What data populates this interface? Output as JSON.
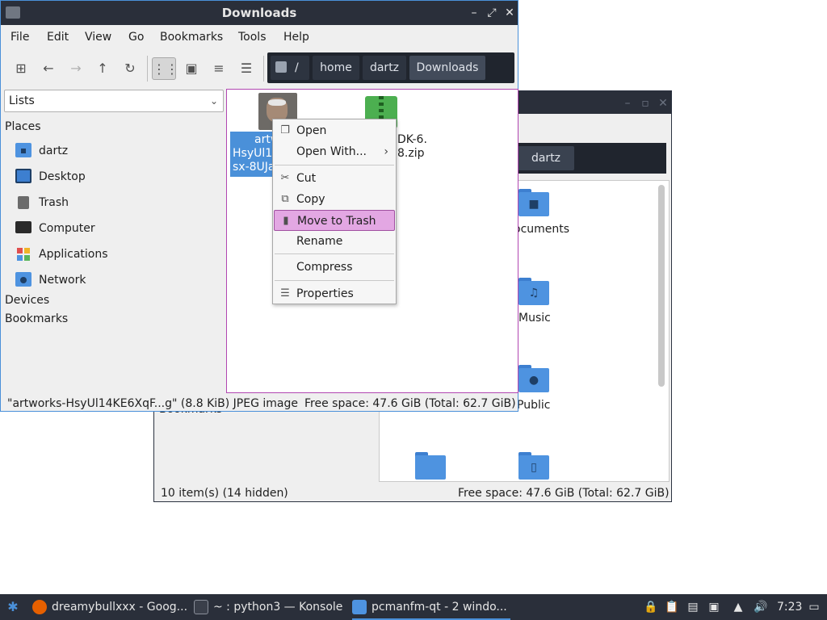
{
  "back_window": {
    "path_current": "dartz",
    "files": [
      {
        "label": "ocuments",
        "glyph": "■"
      },
      {
        "label": "Music",
        "glyph": "♫"
      },
      {
        "label": "Public",
        "glyph": "●"
      },
      {
        "label": "",
        "glyph": ""
      },
      {
        "label": "",
        "glyph": "▯"
      }
    ],
    "obscured_sidebar_text": "Bookmarks",
    "status_left": "10 item(s) (14 hidden)",
    "status_right": "Free space: 47.6 GiB (Total: 62.7 GiB)"
  },
  "window": {
    "title": "Downloads",
    "menu": [
      "File",
      "Edit",
      "View",
      "Go",
      "Bookmarks",
      "Tools",
      "Help"
    ],
    "path": [
      "home",
      "dartz",
      "Downloads"
    ],
    "path_root": "/"
  },
  "sidebar": {
    "view_select": "Lists",
    "places_header": "Places",
    "places": [
      {
        "label": "dartz",
        "icon": "home-folder-icon"
      },
      {
        "label": "Desktop",
        "icon": "desktop-icon"
      },
      {
        "label": "Trash",
        "icon": "trash-icon"
      },
      {
        "label": "Computer",
        "icon": "computer-icon"
      },
      {
        "label": "Applications",
        "icon": "applications-icon"
      },
      {
        "label": "Network",
        "icon": "network-icon"
      }
    ],
    "devices_header": "Devices",
    "bookmarks_header": "Bookmarks"
  },
  "files": [
    {
      "name_lines": [
        "artw",
        "HsyUl14",
        "sx-8UJa"
      ],
      "type": "jpeg",
      "selected": true
    },
    {
      "name_lines": [
        "DK-6.",
        "8.zip"
      ],
      "type": "zip",
      "selected": false
    }
  ],
  "context_menu": {
    "items": [
      {
        "label": "Open",
        "icon": "open-icon"
      },
      {
        "label": "Open With...",
        "icon": "",
        "submenu": true
      },
      {
        "label": "Cut",
        "icon": "scissors-icon"
      },
      {
        "label": "Copy",
        "icon": "copy-icon"
      },
      {
        "label": "Move to Trash",
        "icon": "trash-icon",
        "highlighted": true
      },
      {
        "label": "Rename",
        "icon": ""
      },
      {
        "label": "Compress",
        "icon": ""
      },
      {
        "label": "Properties",
        "icon": "properties-icon"
      }
    ]
  },
  "status": {
    "left": "\"artworks-HsyUl14KE6XqF...g\" (8.8 KiB) JPEG image",
    "right": "Free space: 47.6 GiB (Total: 62.7 GiB)"
  },
  "taskbar": {
    "tasks": [
      {
        "label": "dreamybullxxx - Goog...",
        "icon": "firefox-icon"
      },
      {
        "label": "~ : python3 — Konsole",
        "icon": "terminal-icon"
      },
      {
        "label": "pcmanfm-qt - 2 windo...",
        "icon": "file-manager-icon",
        "active": true
      }
    ],
    "clock": "7:23"
  },
  "colors": {
    "accent": "#4a90d9",
    "highlight": "#e3a7e3",
    "panel": "#2a2f3a"
  }
}
